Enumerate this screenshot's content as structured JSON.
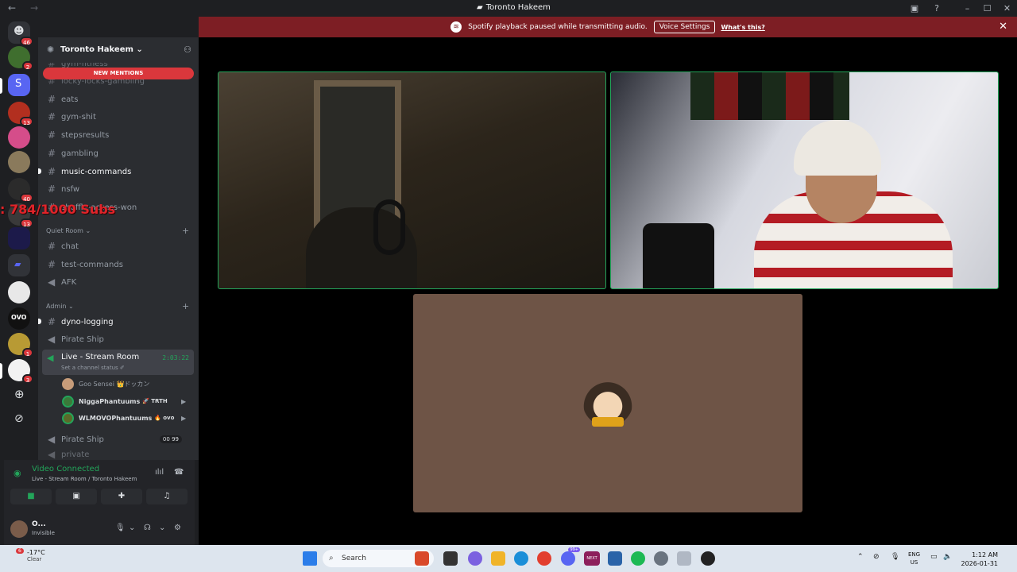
{
  "titlebar": {
    "title": "Toronto Hakeem",
    "back": "←",
    "forward": "→"
  },
  "notice": {
    "text": "Spotify playback paused while transmitting audio.",
    "button": "Voice Settings",
    "link": "What's this?",
    "close": "✕"
  },
  "servers": {
    "badges": [
      "46",
      "2",
      "13",
      "40",
      "13",
      "1",
      "3"
    ]
  },
  "guild": {
    "name": "Toronto Hakeem ⌄",
    "new_mentions": "NEW MENTIONS"
  },
  "channels": {
    "top": [
      "gym-fitness",
      "locky-locks-gambling",
      "eats",
      "gym-shit",
      "stepsresults",
      "gambling",
      "music-commands",
      "nsfw",
      "shuffle-access-won"
    ],
    "quiet_room": {
      "label": "Quiet Room ⌄",
      "items": [
        "chat",
        "test-commands",
        "AFK"
      ]
    },
    "admin": {
      "label": "Admin ⌄",
      "items": [
        "dyno-logging",
        "Pirate Ship"
      ]
    },
    "live": {
      "label": "Live - Stream Room",
      "status": "Set a channel status ✐",
      "timer": "2:03:22"
    },
    "voice_users": [
      {
        "name": "Goo Sensei",
        "tag": "👑ドッカン"
      },
      {
        "name": "NiggaPhantuums",
        "tag": "🚀 TRTH"
      },
      {
        "name": "WLMOVOPhantuums",
        "tag": "🔥 ovo"
      }
    ],
    "pirate2": {
      "label": "Pirate Ship",
      "count": "00",
      "limit": "99"
    },
    "private": "private"
  },
  "overlay": {
    "subs": ": 784/1000  Subs"
  },
  "voice_panel": {
    "title": "Video Connected",
    "subtitle": "Live - Stream Room / Toronto Hakeem"
  },
  "user": {
    "name": "O...",
    "status": "Invisible"
  },
  "taskbar": {
    "weather_temp": "-17°C",
    "weather_desc": "Clear",
    "weather_badge": "6",
    "search": "Search",
    "lang1": "ENG",
    "lang2": "US",
    "time": "1:12 AM",
    "date": "2026-01-31",
    "next_label": "NEXT",
    "discord_badge": "99+"
  }
}
